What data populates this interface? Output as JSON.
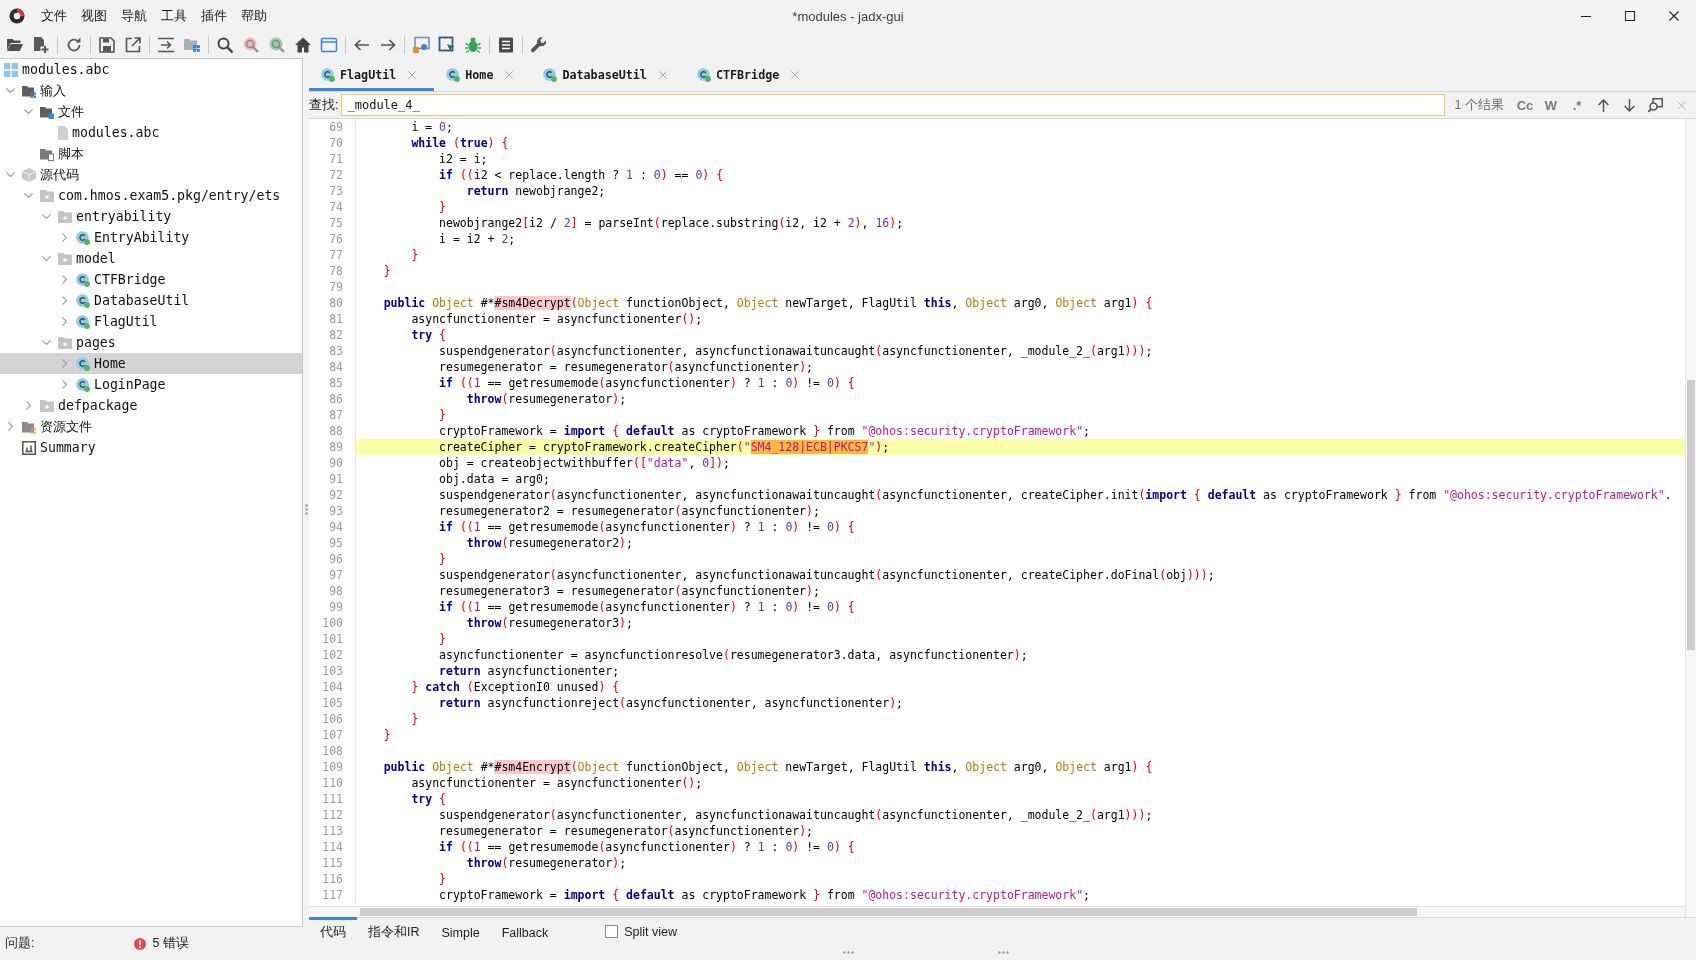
{
  "window": {
    "title": "*modules - jadx-gui"
  },
  "menu": [
    "文件",
    "视图",
    "导航",
    "工具",
    "插件",
    "帮助"
  ],
  "tree": [
    {
      "label": "modules.abc",
      "kind": "project",
      "selected": false,
      "children": [
        {
          "label": "输入",
          "kind": "input",
          "expanded": true,
          "selected": false,
          "children": [
            {
              "label": "文件",
              "kind": "files",
              "expanded": true,
              "selected": false,
              "children": [
                {
                  "label": "modules.abc",
                  "kind": "file",
                  "selected": false
                }
              ]
            },
            {
              "label": "脚本",
              "kind": "scripts",
              "selected": false
            }
          ]
        },
        {
          "label": "源代码",
          "kind": "sources",
          "expanded": true,
          "selected": false,
          "children": [
            {
              "label": "com.hmos.exam5.pkg/entry/ets",
              "kind": "package",
              "expanded": true,
              "selected": false,
              "children": [
                {
                  "label": "entryability",
                  "kind": "package",
                  "expanded": true,
                  "selected": false,
                  "children": [
                    {
                      "label": "EntryAbility",
                      "kind": "class",
                      "expanded": false,
                      "selected": false
                    }
                  ]
                },
                {
                  "label": "model",
                  "kind": "package",
                  "expanded": true,
                  "selected": false,
                  "children": [
                    {
                      "label": "CTFBridge",
                      "kind": "class",
                      "expanded": false,
                      "selected": false
                    },
                    {
                      "label": "DatabaseUtil",
                      "kind": "class",
                      "expanded": false,
                      "selected": false
                    },
                    {
                      "label": "FlagUtil",
                      "kind": "class",
                      "expanded": false,
                      "selected": false
                    }
                  ]
                },
                {
                  "label": "pages",
                  "kind": "package",
                  "expanded": true,
                  "selected": false,
                  "children": [
                    {
                      "label": "Home",
                      "kind": "class",
                      "expanded": false,
                      "selected": true
                    },
                    {
                      "label": "LoginPage",
                      "kind": "class",
                      "expanded": false,
                      "selected": false
                    }
                  ]
                }
              ]
            },
            {
              "label": "defpackage",
              "kind": "package",
              "expanded": false,
              "selected": false
            }
          ]
        },
        {
          "label": "资源文件",
          "kind": "resources",
          "expanded": false,
          "selected": false
        },
        {
          "label": "Summary",
          "kind": "summary",
          "selected": false
        }
      ]
    }
  ],
  "problems": {
    "label": "问题:",
    "errors": "5 错误"
  },
  "editor_tabs": [
    {
      "label": "FlagUtil",
      "selected": true
    },
    {
      "label": "Home",
      "selected": false
    },
    {
      "label": "DatabaseUtil",
      "selected": false
    },
    {
      "label": "CTFBridge",
      "selected": false
    }
  ],
  "search": {
    "label": "查找:",
    "value": "_module_4_",
    "result": "1 个结果",
    "options": [
      {
        "label": "Cc",
        "selected": false
      },
      {
        "label": "W",
        "selected": false
      },
      {
        "label": ".*",
        "selected": false
      }
    ]
  },
  "code": {
    "lines": [
      {
        "number": "69",
        "current": false,
        "tokens": [
          {
            "kind": "code",
            "text": "        i = 0;"
          }
        ]
      },
      {
        "number": "70",
        "current": false,
        "tokens": [
          {
            "kind": "keyword",
            "text": "        while"
          },
          {
            "kind": "code",
            "text": " ("
          },
          {
            "kind": "keyword",
            "text": "true"
          },
          {
            "kind": "code",
            "text": ") {"
          }
        ]
      },
      {
        "number": "71",
        "current": false,
        "tokens": [
          {
            "kind": "code",
            "text": "            i2 = i;"
          }
        ]
      },
      {
        "number": "72",
        "current": false,
        "tokens": [
          {
            "kind": "keyword",
            "text": "            if"
          },
          {
            "kind": "code",
            "text": " ((i2 < replace.length ? 1 : 0) == 0) {"
          }
        ]
      },
      {
        "number": "73",
        "current": false,
        "tokens": [
          {
            "kind": "keyword",
            "text": "                return"
          },
          {
            "kind": "code",
            "text": " newobjrange2;"
          }
        ]
      },
      {
        "number": "74",
        "current": false,
        "tokens": [
          {
            "kind": "code",
            "text": "            }"
          }
        ]
      },
      {
        "number": "75",
        "current": false,
        "tokens": [
          {
            "kind": "code",
            "text": "            newobjrange2[i2 / 2] = parseInt(replace.substring(i2, i2 + 2), 16);"
          }
        ]
      },
      {
        "number": "76",
        "current": false,
        "tokens": [
          {
            "kind": "code",
            "text": "            i = i2 + 2;"
          }
        ]
      },
      {
        "number": "77",
        "current": false,
        "tokens": [
          {
            "kind": "code",
            "text": "        }"
          }
        ]
      },
      {
        "number": "78",
        "current": false,
        "tokens": [
          {
            "kind": "code",
            "text": "    }"
          }
        ]
      },
      {
        "number": "79",
        "current": false
      },
      {
        "number": "80",
        "current": false,
        "tokens": [
          {
            "kind": "keyword",
            "text": "    public"
          },
          {
            "kind": "type",
            "text": " Object"
          },
          {
            "kind": "code",
            "text": " #*"
          },
          {
            "kind": "mark",
            "text": "#sm4Decrypt"
          },
          {
            "kind": "code",
            "text": "("
          },
          {
            "kind": "type",
            "text": "Object"
          },
          {
            "kind": "code",
            "text": " functionObject, "
          },
          {
            "kind": "type",
            "text": "Object"
          },
          {
            "kind": "code",
            "text": " newTarget, FlagUtil "
          },
          {
            "kind": "keyword",
            "text": "this"
          },
          {
            "kind": "code",
            "text": ", "
          },
          {
            "kind": "type",
            "text": "Object"
          },
          {
            "kind": "code",
            "text": " arg0, "
          },
          {
            "kind": "type",
            "text": "Object"
          },
          {
            "kind": "code",
            "text": " arg1) {"
          }
        ]
      },
      {
        "number": "81",
        "current": false,
        "tokens": [
          {
            "kind": "code",
            "text": "        asyncfunctionenter = asyncfunctionenter();"
          }
        ]
      },
      {
        "number": "82",
        "current": false,
        "tokens": [
          {
            "kind": "keyword",
            "text": "        try"
          },
          {
            "kind": "code",
            "text": " {"
          }
        ]
      },
      {
        "number": "83",
        "current": false,
        "tokens": [
          {
            "kind": "code",
            "text": "            suspendgenerator(asyncfunctionenter, asyncfunctionawaituncaught(asyncfunctionenter, _module_2_(arg1)));"
          }
        ]
      },
      {
        "number": "84",
        "current": false,
        "tokens": [
          {
            "kind": "code",
            "text": "            resumegenerator = resumegenerator(asyncfunctionenter);"
          }
        ]
      },
      {
        "number": "85",
        "current": false,
        "tokens": [
          {
            "kind": "keyword",
            "text": "            if"
          },
          {
            "kind": "code",
            "text": " ((1 == getresumemode(asyncfunctionenter) ? 1 : 0) != 0) {"
          }
        ]
      },
      {
        "number": "86",
        "current": false,
        "tokens": [
          {
            "kind": "keyword",
            "text": "                throw"
          },
          {
            "kind": "code",
            "text": "(resumegenerator);"
          }
        ]
      },
      {
        "number": "87",
        "current": false,
        "tokens": [
          {
            "kind": "code",
            "text": "            }"
          }
        ]
      },
      {
        "number": "88",
        "current": false,
        "tokens": [
          {
            "kind": "code",
            "text": "            cryptoFramework = "
          },
          {
            "kind": "keyword",
            "text": "import"
          },
          {
            "kind": "code",
            "text": " { "
          },
          {
            "kind": "keyword",
            "text": "default"
          },
          {
            "kind": "code",
            "text": " as cryptoFramework } from "
          },
          {
            "kind": "string",
            "text": "\"@ohos:security.cryptoFramework\""
          },
          {
            "kind": "code",
            "text": ";"
          }
        ]
      },
      {
        "number": "89",
        "current": true,
        "tokens": [
          {
            "kind": "code",
            "text": "            createCipher = cryptoFramework.createCipher("
          },
          {
            "kind": "string",
            "text": "\""
          },
          {
            "kind": "match",
            "text": "SM4_128|ECB|PKCS7"
          },
          {
            "kind": "string",
            "text": "\""
          },
          {
            "kind": "code",
            "text": ");"
          }
        ]
      },
      {
        "number": "90",
        "current": false,
        "tokens": [
          {
            "kind": "code",
            "text": "            obj = createobjectwithbuffer(["
          },
          {
            "kind": "string",
            "text": "\"data\""
          },
          {
            "kind": "code",
            "text": ", 0]);"
          }
        ]
      },
      {
        "number": "91",
        "current": false,
        "tokens": [
          {
            "kind": "code",
            "text": "            obj.data = arg0;"
          }
        ]
      },
      {
        "number": "92",
        "current": false,
        "tokens": [
          {
            "kind": "code",
            "text": "            suspendgenerator(asyncfunctionenter, asyncfunctionawaituncaught(asyncfunctionenter, createCipher.init("
          },
          {
            "kind": "keyword",
            "text": "import"
          },
          {
            "kind": "code",
            "text": " { "
          },
          {
            "kind": "keyword",
            "text": "default"
          },
          {
            "kind": "code",
            "text": " as cryptoFramework } from "
          },
          {
            "kind": "string",
            "text": "\"@ohos:security.cryptoFramework\""
          },
          {
            "kind": "code",
            "text": "."
          }
        ]
      },
      {
        "number": "93",
        "current": false,
        "tokens": [
          {
            "kind": "code",
            "text": "            resumegenerator2 = resumegenerator(asyncfunctionenter);"
          }
        ]
      },
      {
        "number": "94",
        "current": false,
        "tokens": [
          {
            "kind": "keyword",
            "text": "            if"
          },
          {
            "kind": "code",
            "text": " ((1 == getresumemode(asyncfunctionenter) ? 1 : 0) != 0) {"
          }
        ]
      },
      {
        "number": "95",
        "current": false,
        "tokens": [
          {
            "kind": "keyword",
            "text": "                throw"
          },
          {
            "kind": "code",
            "text": "(resumegenerator2);"
          }
        ]
      },
      {
        "number": "96",
        "current": false,
        "tokens": [
          {
            "kind": "code",
            "text": "            }"
          }
        ]
      },
      {
        "number": "97",
        "current": false,
        "tokens": [
          {
            "kind": "code",
            "text": "            suspendgenerator(asyncfunctionenter, asyncfunctionawaituncaught(asyncfunctionenter, createCipher.doFinal(obj)));"
          }
        ]
      },
      {
        "number": "98",
        "current": false,
        "tokens": [
          {
            "kind": "code",
            "text": "            resumegenerator3 = resumegenerator(asyncfunctionenter);"
          }
        ]
      },
      {
        "number": "99",
        "current": false,
        "tokens": [
          {
            "kind": "keyword",
            "text": "            if"
          },
          {
            "kind": "code",
            "text": " ((1 == getresumemode(asyncfunctionenter) ? 1 : 0) != 0) {"
          }
        ]
      },
      {
        "number": "100",
        "current": false,
        "tokens": [
          {
            "kind": "keyword",
            "text": "                throw"
          },
          {
            "kind": "code",
            "text": "(resumegenerator3);"
          }
        ]
      },
      {
        "number": "101",
        "current": false,
        "tokens": [
          {
            "kind": "code",
            "text": "            }"
          }
        ]
      },
      {
        "number": "102",
        "current": false,
        "tokens": [
          {
            "kind": "code",
            "text": "            asyncfunctionenter = asyncfunctionresolve(resumegenerator3.data, asyncfunctionenter);"
          }
        ]
      },
      {
        "number": "103",
        "current": false,
        "tokens": [
          {
            "kind": "keyword",
            "text": "            return"
          },
          {
            "kind": "code",
            "text": " asyncfunctionenter;"
          }
        ]
      },
      {
        "number": "104",
        "current": false,
        "tokens": [
          {
            "kind": "code",
            "text": "        } "
          },
          {
            "kind": "keyword",
            "text": "catch"
          },
          {
            "kind": "code",
            "text": " (ExceptionI0 unused) {"
          }
        ]
      },
      {
        "number": "105",
        "current": false,
        "tokens": [
          {
            "kind": "keyword",
            "text": "            return"
          },
          {
            "kind": "code",
            "text": " asyncfunctionreject(asyncfunctionenter, asyncfunctionenter);"
          }
        ]
      },
      {
        "number": "106",
        "current": false,
        "tokens": [
          {
            "kind": "code",
            "text": "        }"
          }
        ]
      },
      {
        "number": "107",
        "current": false,
        "tokens": [
          {
            "kind": "code",
            "text": "    }"
          }
        ]
      },
      {
        "number": "108",
        "current": false
      },
      {
        "number": "109",
        "current": false,
        "tokens": [
          {
            "kind": "keyword",
            "text": "    public"
          },
          {
            "kind": "type",
            "text": " Object"
          },
          {
            "kind": "code",
            "text": " #*"
          },
          {
            "kind": "mark",
            "text": "#sm4Encrypt"
          },
          {
            "kind": "code",
            "text": "("
          },
          {
            "kind": "type",
            "text": "Object"
          },
          {
            "kind": "code",
            "text": " functionObject, "
          },
          {
            "kind": "type",
            "text": "Object"
          },
          {
            "kind": "code",
            "text": " newTarget, FlagUtil "
          },
          {
            "kind": "keyword",
            "text": "this"
          },
          {
            "kind": "code",
            "text": ", "
          },
          {
            "kind": "type",
            "text": "Object"
          },
          {
            "kind": "code",
            "text": " arg0, "
          },
          {
            "kind": "type",
            "text": "Object"
          },
          {
            "kind": "code",
            "text": " arg1) {"
          }
        ]
      },
      {
        "number": "110",
        "current": false,
        "tokens": [
          {
            "kind": "code",
            "text": "        asyncfunctionenter = asyncfunctionenter();"
          }
        ]
      },
      {
        "number": "111",
        "current": false,
        "tokens": [
          {
            "kind": "keyword",
            "text": "        try"
          },
          {
            "kind": "code",
            "text": " {"
          }
        ]
      },
      {
        "number": "112",
        "current": false,
        "tokens": [
          {
            "kind": "code",
            "text": "            suspendgenerator(asyncfunctionenter, asyncfunctionawaituncaught(asyncfunctionenter, _module_2_(arg1)));"
          }
        ]
      },
      {
        "number": "113",
        "current": false,
        "tokens": [
          {
            "kind": "code",
            "text": "            resumegenerator = resumegenerator(asyncfunctionenter);"
          }
        ]
      },
      {
        "number": "114",
        "current": false,
        "tokens": [
          {
            "kind": "keyword",
            "text": "            if"
          },
          {
            "kind": "code",
            "text": " ((1 == getresumemode(asyncfunctionenter) ? 1 : 0) != 0) {"
          }
        ]
      },
      {
        "number": "115",
        "current": false,
        "tokens": [
          {
            "kind": "keyword",
            "text": "                throw"
          },
          {
            "kind": "code",
            "text": "(resumegenerator);"
          }
        ]
      },
      {
        "number": "116",
        "current": false,
        "tokens": [
          {
            "kind": "code",
            "text": "            }"
          }
        ]
      },
      {
        "number": "117",
        "current": false,
        "tokens": [
          {
            "kind": "code",
            "text": "            cryptoFramework = "
          },
          {
            "kind": "keyword",
            "text": "import"
          },
          {
            "kind": "code",
            "text": " { "
          },
          {
            "kind": "keyword",
            "text": "default"
          },
          {
            "kind": "code",
            "text": " as cryptoFramework } from "
          },
          {
            "kind": "string",
            "text": "\"@ohos:security.cryptoFramework\""
          },
          {
            "kind": "code",
            "text": ";"
          }
        ]
      }
    ]
  },
  "view_tabs": [
    {
      "label": "代码",
      "selected": true
    },
    {
      "label": "指令和IR",
      "selected": false
    },
    {
      "label": "Simple",
      "selected": false
    },
    {
      "label": "Fallback",
      "selected": false
    }
  ],
  "split_view": {
    "label": "Split view",
    "checked": false
  }
}
